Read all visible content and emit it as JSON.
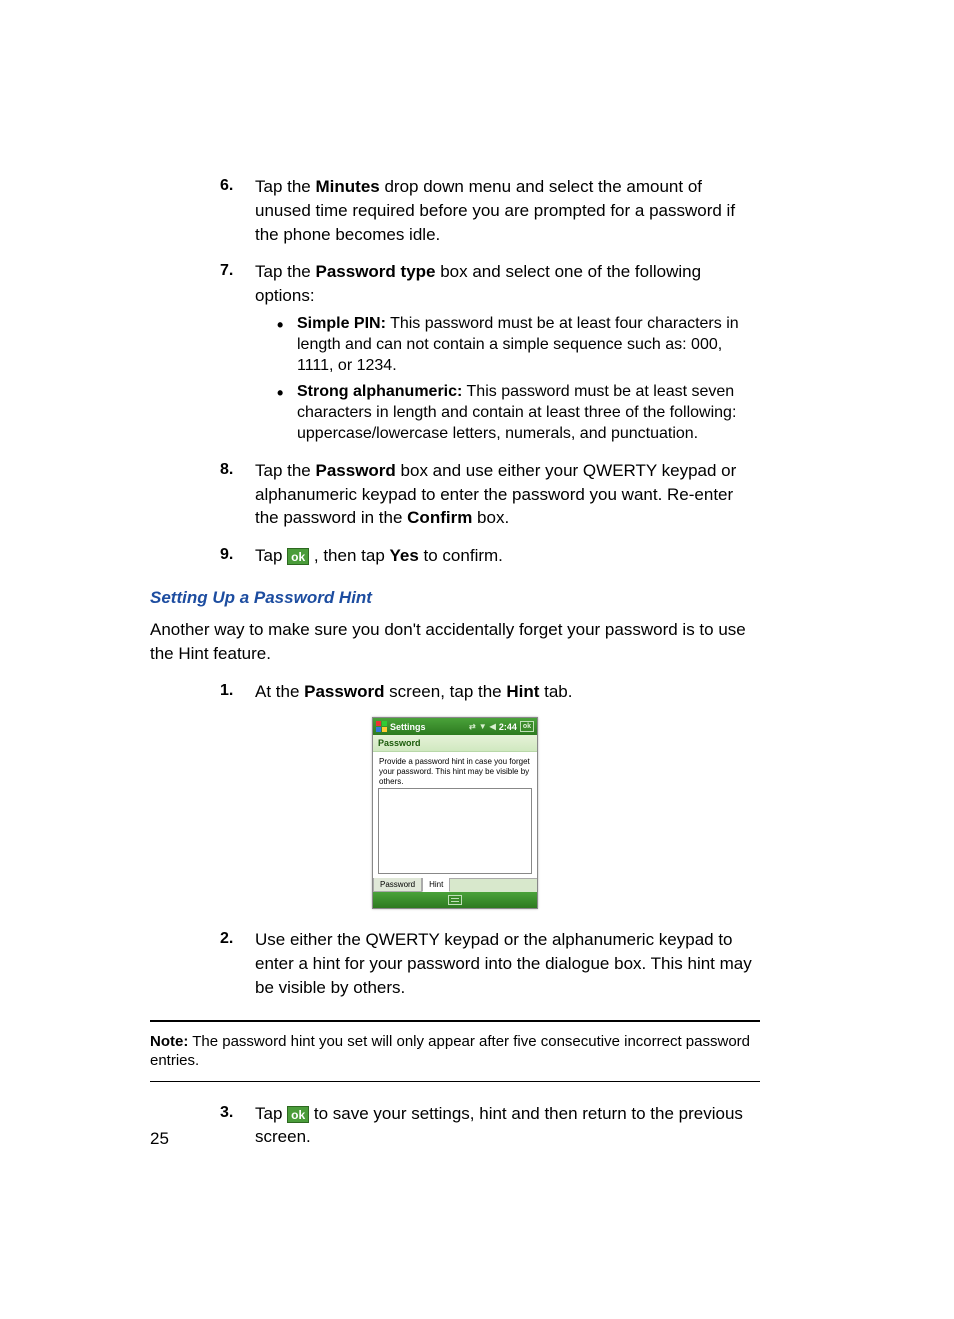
{
  "steps_a": [
    {
      "num": "6.",
      "pre": "Tap the ",
      "bold": "Minutes",
      "post": " drop down menu and select the amount of unused time required before you are prompted for a password if the phone becomes idle."
    },
    {
      "num": "7.",
      "pre": "Tap the ",
      "bold": "Password type",
      "post": " box and select one of the following options:"
    }
  ],
  "bullets_7": [
    {
      "bold": "Simple PIN:",
      "text": " This password must be at least four characters in length and can not contain a simple sequence such as: 000, 1111, or 1234."
    },
    {
      "bold": "Strong alphanumeric:",
      "text": " This password must be at least seven characters in length and contain at least three of the following: uppercase/lowercase letters, numerals, and punctuation."
    }
  ],
  "step8": {
    "num": "8.",
    "pre": "Tap the ",
    "bold1": "Password",
    "mid": " box and use either your QWERTY keypad or alphanumeric keypad to enter the password you want. Re-enter the password in the ",
    "bold2": "Confirm",
    "post": " box."
  },
  "step9": {
    "num": "9.",
    "pre": "Tap ",
    "ok": "ok",
    "mid": " , then tap ",
    "bold": "Yes",
    "post": " to confirm."
  },
  "heading": "Setting Up a Password Hint",
  "intro": "Another way to make sure you don't accidentally forget your password is to use the Hint feature.",
  "hint_step1": {
    "num": "1.",
    "pre": "At the ",
    "bold1": "Password",
    "mid": " screen, tap the ",
    "bold2": "Hint",
    "post": " tab."
  },
  "wm": {
    "title": "Settings",
    "time": "2:44",
    "ok": "ok",
    "subhead": "Password",
    "body": "Provide a password hint in case you forget your password.  This hint may be visible by others.",
    "tab1": "Password",
    "tab2": "Hint"
  },
  "hint_step2": {
    "num": "2.",
    "text": "Use either the QWERTY keypad or the alphanumeric keypad to enter a hint for your password into the dialogue box. This hint may be visible by others."
  },
  "note": {
    "label": "Note:",
    "text": " The password hint you set will only appear after five consecutive incorrect password entries."
  },
  "hint_step3": {
    "num": "3.",
    "pre": "Tap ",
    "ok": "ok",
    "post": " to save your settings, hint and then return to the previous screen."
  },
  "page": "25"
}
